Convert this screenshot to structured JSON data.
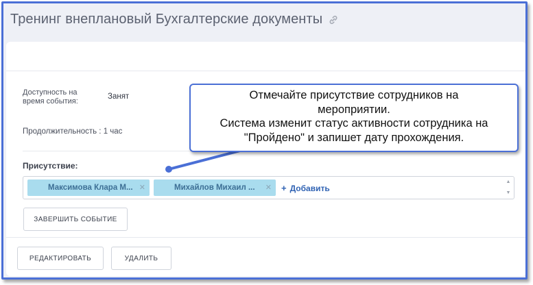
{
  "page": {
    "title": "Тренинг внеплановый Бухгалтерские документы"
  },
  "details": {
    "availability_label_line1": "Доступность на",
    "availability_label_line2": "время события:",
    "availability_value": "Занят",
    "duration_label": "Продолжительность :",
    "duration_value": "1 час"
  },
  "attendance": {
    "label": "Присутствие:",
    "attendees": [
      {
        "name": "Максимова Клара М..."
      },
      {
        "name": "Михайлов Михаил ..."
      }
    ],
    "add_label": "Добавить"
  },
  "actions": {
    "finish_event": "ЗАВЕРШИТЬ СОБЫТИЕ",
    "edit": "РЕДАКТИРОВАТЬ",
    "delete": "УДАЛИТЬ"
  },
  "tooltip": {
    "line1": "Отмечайте присутствие сотрудников на",
    "line2": "мероприятии.",
    "line3": "Система изменит статус активности сотрудника на",
    "line4": "\"Пройдено\" и запишет дату прохождения."
  },
  "icons": {
    "link": "link-icon",
    "remove": "close-icon",
    "add": "plus-icon",
    "scroll": "scroll-arrows-icon"
  },
  "colors": {
    "accent_border": "#4a6fd6",
    "chip_background": "#a9dcee",
    "chip_text": "#3d6f95",
    "link": "#2f62b3",
    "page_background": "#eef0f6"
  }
}
